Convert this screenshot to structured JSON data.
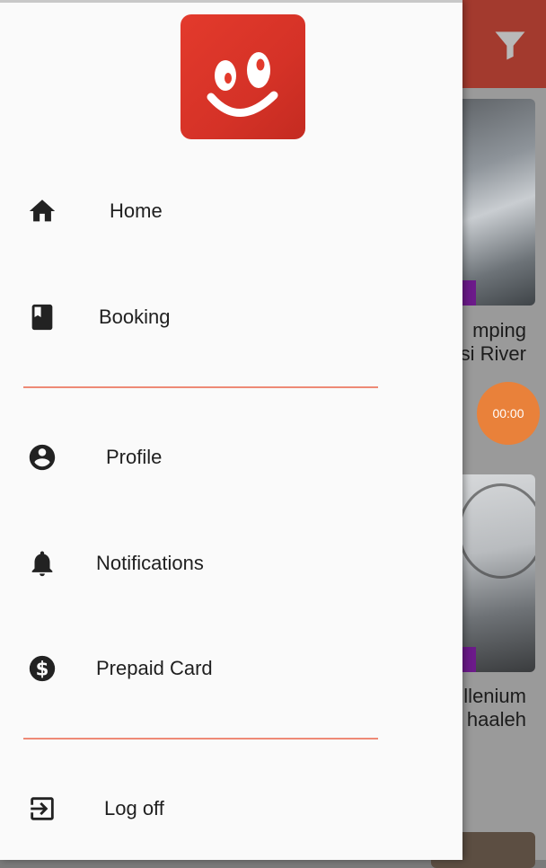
{
  "background": {
    "cards": [
      {
        "title_line1": "mping",
        "title_line2": "si River"
      },
      {
        "title_line1": "llenium",
        "title_line2": "haaleh"
      }
    ],
    "timer": "00:00",
    "filter_icon": "filter-icon"
  },
  "drawer": {
    "logo": "smiley-logo",
    "items": [
      {
        "label": "Home",
        "icon": "home-icon"
      },
      {
        "label": "Booking",
        "icon": "book-icon"
      },
      {
        "label": "Profile",
        "icon": "account-circle-icon"
      },
      {
        "label": "Notifications",
        "icon": "bell-icon"
      },
      {
        "label": "Prepaid Card",
        "icon": "dollar-circle-icon"
      },
      {
        "label": "Log off",
        "icon": "exit-icon"
      }
    ],
    "colors": {
      "accent": "#e33a2c",
      "divider": "#ee8a76",
      "timer": "#e9813a"
    }
  }
}
